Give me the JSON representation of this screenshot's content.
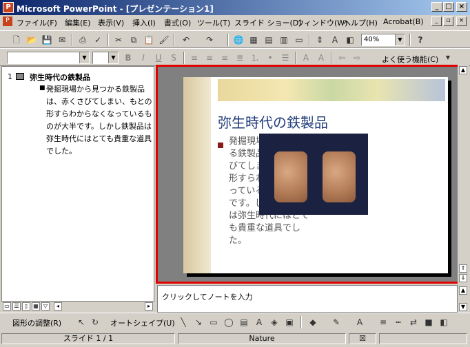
{
  "window": {
    "title": "Microsoft PowerPoint - [プレゼンテーション1]",
    "app_icon": "powerpoint-icon"
  },
  "menu": [
    "ファイル(F)",
    "編集(E)",
    "表示(V)",
    "挿入(I)",
    "書式(O)",
    "ツール(T)",
    "スライド ショー(D)",
    "ウィンドウ(W)",
    "ヘルプ(H)",
    "Acrobat(B)"
  ],
  "toolbar": {
    "zoom": "40%",
    "help_label": "?"
  },
  "format_toolbar": {
    "font": "",
    "size": "",
    "common_tasks": "よく使う機能(C)"
  },
  "outline": {
    "slide_number": "1",
    "title": "弥生時代の鉄製品",
    "body": "発掘現場から見つかる鉄製品は、赤くさびてしまい、もとの形すらわからなくなっているものが大半です。しかし鉄製品は弥生時代にはとても貴重な道具でした。"
  },
  "slide": {
    "title": "弥生時代の鉄製品",
    "body": "発掘現場から見つかる鉄製品は、赤くさびてしまい、もとの形すらわからなくなっているものが大半です。しかし鉄製品は弥生時代にはとても貴重な道具でした。"
  },
  "notes": {
    "placeholder": "クリックしてノートを入力"
  },
  "drawbar": {
    "draw": "図形の調整(R)",
    "autoshape": "オートシェイプ(U)"
  },
  "status": {
    "slide": "スライド 1 / 1",
    "design": "Nature"
  }
}
